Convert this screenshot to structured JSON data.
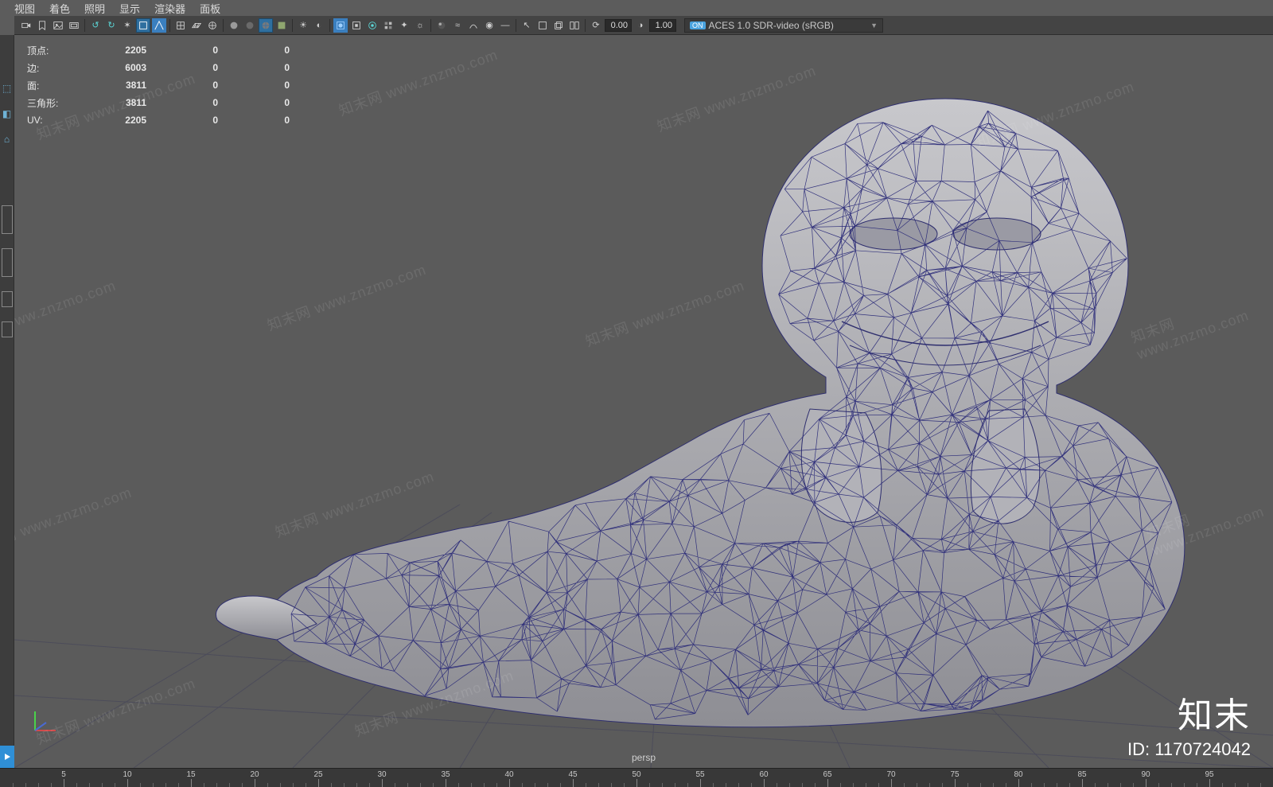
{
  "menu": {
    "items": [
      "视图",
      "着色",
      "照明",
      "显示",
      "渲染器",
      "面板"
    ]
  },
  "toolbar": {
    "num1": "0.00",
    "num2": "1.00",
    "color_mgmt_on": "ON",
    "color_mgmt_label": "ACES 1.0 SDR-video (sRGB)"
  },
  "stats": {
    "rows": [
      {
        "label": "顶点:",
        "v1": "2205",
        "v2": "0",
        "v3": "0"
      },
      {
        "label": "边:",
        "v1": "6003",
        "v2": "0",
        "v3": "0"
      },
      {
        "label": "面:",
        "v1": "3811",
        "v2": "0",
        "v3": "0"
      },
      {
        "label": "三角形:",
        "v1": "3811",
        "v2": "0",
        "v3": "0"
      },
      {
        "label": "UV:",
        "v1": "2205",
        "v2": "0",
        "v3": "0"
      }
    ]
  },
  "viewport": {
    "camera_label": "persp"
  },
  "timeline": {
    "ticks": [
      5,
      10,
      15,
      20,
      25,
      30,
      35,
      40,
      45,
      50,
      55,
      60,
      65,
      70,
      75,
      80,
      85,
      90,
      95
    ]
  },
  "brand": {
    "name": "知末",
    "id_label": "ID: 1170724042"
  },
  "watermark_text": "知末网 www.znzmo.com"
}
